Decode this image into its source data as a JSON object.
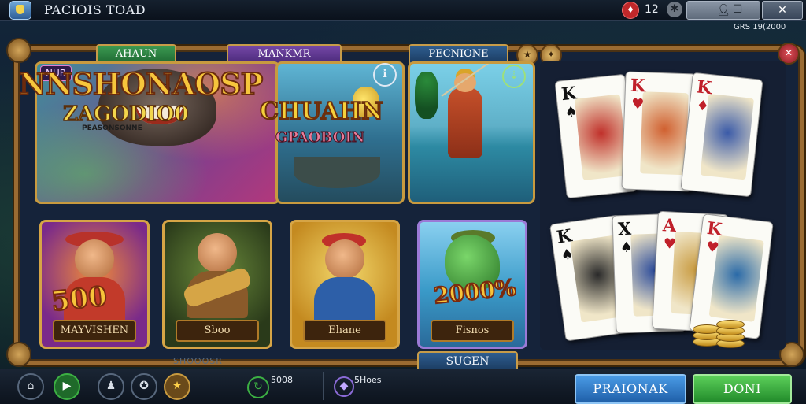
{
  "window": {
    "title": "PACIOIS TOAD",
    "notification_count": "12",
    "version": "GRS 19(2000"
  },
  "tabs": {
    "left": "AHAUN",
    "middle": "MANKMR",
    "right": "PECNIONE"
  },
  "featured": {
    "badge": "NUB",
    "title": "NNSHONAOSP",
    "subtitle": "ZAGODIO0",
    "caption": "PEASONSONNE"
  },
  "middle_tile": {
    "title": "CHUAHN",
    "subtitle": "GPAOBOIN"
  },
  "games": [
    {
      "label": "MAYVISHEN",
      "amount": "500"
    },
    {
      "label": "Sboo",
      "amount": ""
    },
    {
      "label": "Ehane",
      "amount": ""
    },
    {
      "label": "Fisnos",
      "amount": "2000%"
    }
  ],
  "cards_top": [
    {
      "rank": "K",
      "suit": "♠",
      "color": "#111111"
    },
    {
      "rank": "K",
      "suit": "♥",
      "color": "#c0202a"
    },
    {
      "rank": "K",
      "suit": "♦",
      "color": "#c0202a"
    }
  ],
  "cards_bottom": [
    {
      "rank": "K",
      "suit": "♠",
      "color": "#111111"
    },
    {
      "rank": "X",
      "suit": "♠",
      "color": "#111111"
    },
    {
      "rank": "A",
      "suit": "♥",
      "color": "#c0202a"
    },
    {
      "rank": "K",
      "suit": "♥",
      "color": "#c0202a"
    }
  ],
  "center_label": "SUGEN",
  "faded_text": "SHOOOSR",
  "bottom": {
    "status_left": "5008",
    "status_right": "5Hoes",
    "primary_button": "PRAIONAK",
    "secondary_button": "DONI"
  },
  "colors": {
    "frame_gold": "#c89a3f",
    "primary_blue": "#2f7fd0",
    "go_green": "#3cb043"
  }
}
